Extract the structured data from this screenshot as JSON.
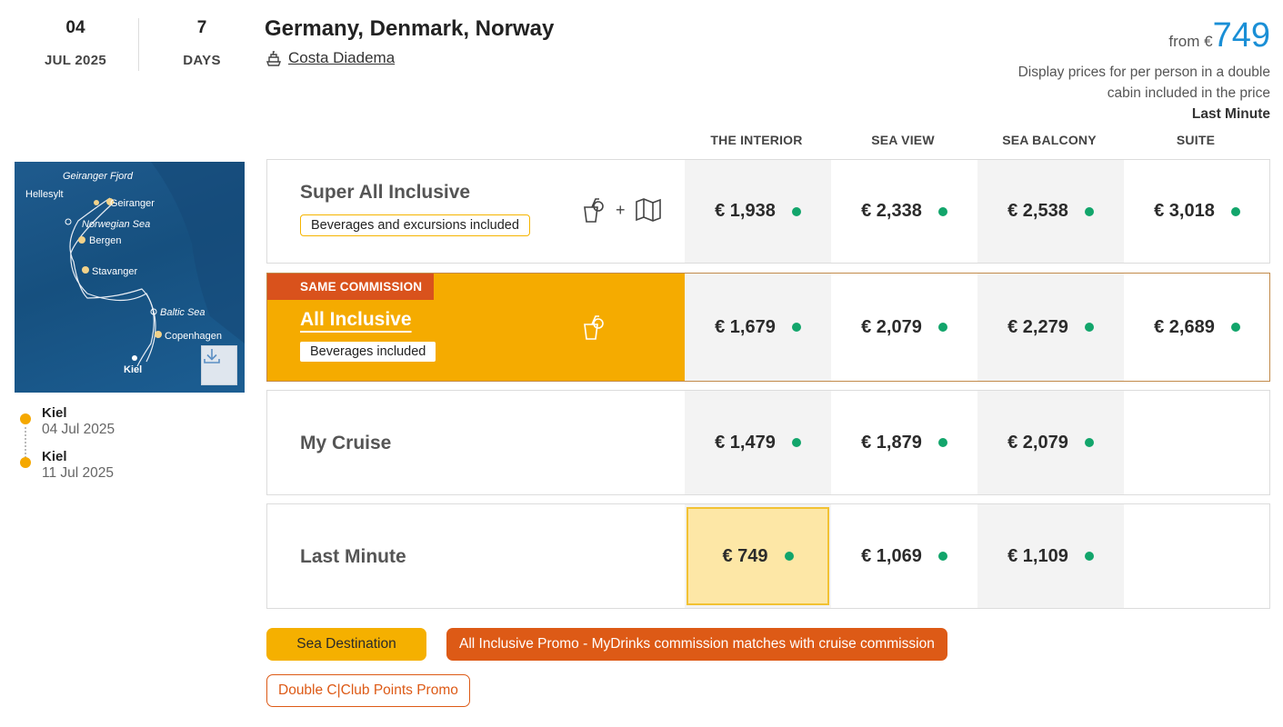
{
  "departure": {
    "day": "04",
    "month_year": "JUL 2025"
  },
  "duration": {
    "value": "7",
    "unit": "DAYS"
  },
  "title": "Germany, Denmark, Norway",
  "ship": {
    "icon": "ship-icon",
    "name": "Costa Diadema"
  },
  "price_from": {
    "label": "from €",
    "value": "749",
    "note": "Display prices for per person in a double cabin included in the price",
    "fare": "Last Minute"
  },
  "map": {
    "labels": [
      "Geiranger Fjord",
      "Hellesylt",
      "Geiranger",
      "Norwegian Sea",
      "Bergen",
      "Stavanger",
      "Baltic Sea",
      "Copenhagen",
      "Kiel"
    ],
    "download_icon": "download-icon"
  },
  "itinerary": [
    {
      "port": "Kiel",
      "date": "04 Jul 2025"
    },
    {
      "port": "Kiel",
      "date": "11 Jul 2025"
    }
  ],
  "cabins": [
    "THE INTERIOR",
    "SEA VIEW",
    "SEA BALCONY",
    "SUITE"
  ],
  "fares": [
    {
      "name": "Super All Inclusive",
      "tag": "Beverages and excursions included",
      "prices": [
        "€ 1,938",
        "€ 2,338",
        "€ 2,538",
        "€ 3,018"
      ]
    },
    {
      "name": "All Inclusive",
      "badge": "SAME COMMISSION",
      "tag": "Beverages included",
      "prices": [
        "€ 1,679",
        "€ 2,079",
        "€ 2,279",
        "€ 2,689"
      ]
    },
    {
      "name": "My Cruise",
      "prices": [
        "€ 1,479",
        "€ 1,879",
        "€ 2,079"
      ]
    },
    {
      "name": "Last Minute",
      "prices": [
        "€ 749",
        "€ 1,069",
        "€ 1,109"
      ]
    }
  ],
  "promos": [
    "Sea Destination",
    "All Inclusive Promo - MyDrinks commission matches with cruise commission",
    "Double C|Club Points Promo"
  ],
  "colors": {
    "accent_blue": "#1a8fd6",
    "yellow": "#f5ab00",
    "orange": "#dd5a16",
    "available": "#12a56b"
  }
}
